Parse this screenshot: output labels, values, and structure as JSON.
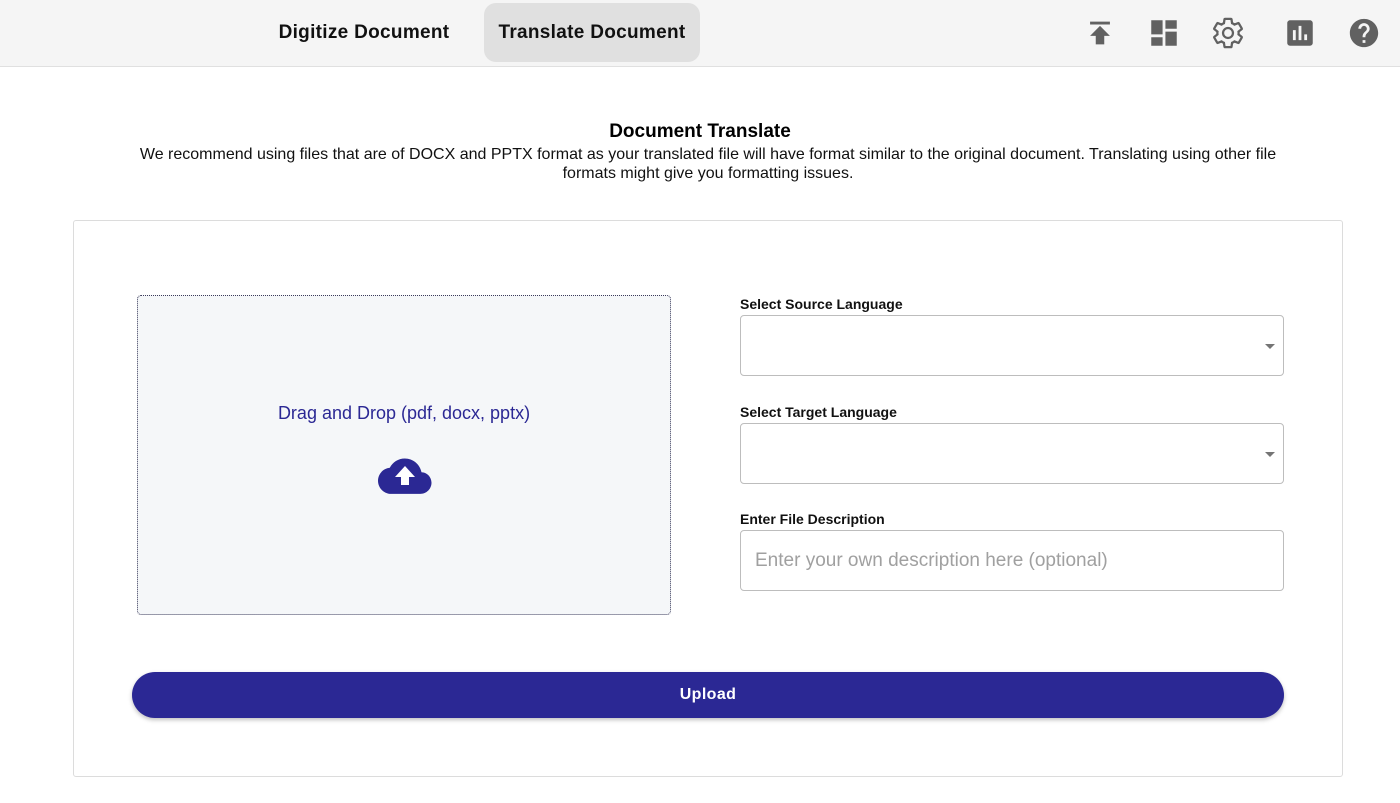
{
  "nav": {
    "tabs": [
      {
        "label": "Digitize Document",
        "active": false
      },
      {
        "label": "Translate Document",
        "active": true
      }
    ],
    "icons": [
      "upload-icon",
      "dashboard-icon",
      "settings-gear-icon",
      "analytics-icon",
      "help-icon"
    ]
  },
  "header": {
    "title": "Document Translate",
    "description": "We recommend using files that are of DOCX and PPTX format as your translated file will have format similar to the original document. Translating using other file formats might give you formatting issues."
  },
  "dropzone": {
    "text": "Drag and Drop (pdf, docx, pptx)",
    "icon": "cloud-upload-icon"
  },
  "form": {
    "source_label": "Select Source Language",
    "source_value": "",
    "target_label": "Select Target Language",
    "target_value": "",
    "description_label": "Enter File Description",
    "description_value": "",
    "description_placeholder": "Enter your own description here (optional)"
  },
  "upload_button": "Upload",
  "colors": {
    "accent": "#2b2894",
    "topbar_bg": "#f5f5f5",
    "active_tab_bg": "#e0e0e0",
    "icon_gray": "#616161"
  }
}
